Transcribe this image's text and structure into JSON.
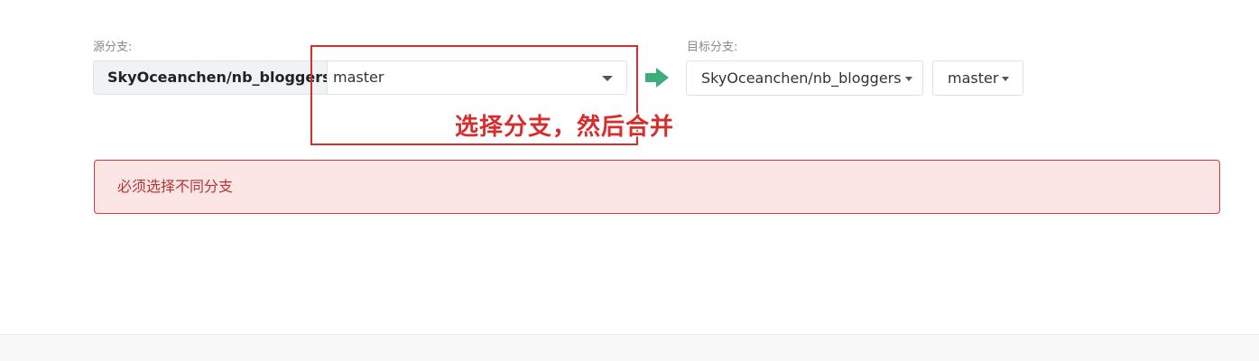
{
  "source": {
    "label": "源分支:",
    "repo": "SkyOceanchen/nb_bloggers",
    "branch": "master"
  },
  "target": {
    "label": "目标分支:",
    "repo": "SkyOceanchen/nb_bloggers",
    "branch": "master"
  },
  "annotation": {
    "text": "选择分支，然后合并",
    "color": "#d62d2d"
  },
  "alert": {
    "message": "必须选择不同分支"
  },
  "colors": {
    "arrow": "#3dae7a",
    "alert_bg": "#fbe5e5",
    "alert_border": "#d83b3b"
  },
  "icons": {
    "arrow": "arrow-right-icon",
    "caret": "caret-down-icon"
  }
}
